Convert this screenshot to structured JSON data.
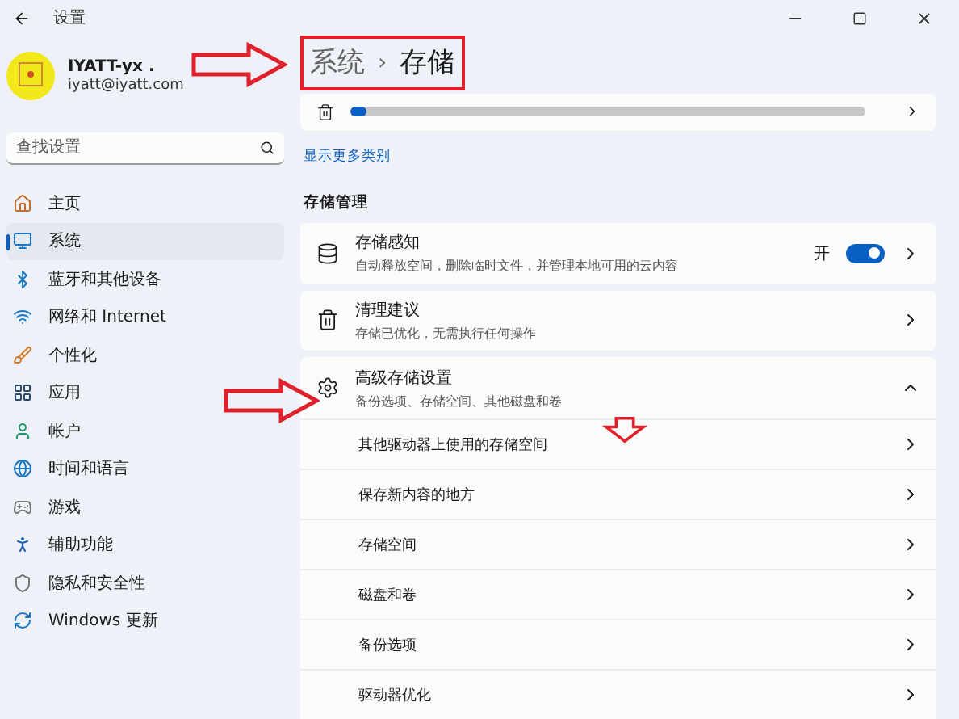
{
  "window": {
    "title": "设置"
  },
  "account": {
    "name": "IYATT-yx .",
    "email": "iyatt@iyatt.com"
  },
  "search": {
    "placeholder": "查找设置"
  },
  "nav": [
    {
      "label": "主页",
      "selected": false
    },
    {
      "label": "系统",
      "selected": true
    },
    {
      "label": "蓝牙和其他设备",
      "selected": false
    },
    {
      "label": "网络和 Internet",
      "selected": false
    },
    {
      "label": "个性化",
      "selected": false
    },
    {
      "label": "应用",
      "selected": false
    },
    {
      "label": "帐户",
      "selected": false
    },
    {
      "label": "时间和语言",
      "selected": false
    },
    {
      "label": "游戏",
      "selected": false
    },
    {
      "label": "辅助功能",
      "selected": false
    },
    {
      "label": "隐私和安全性",
      "selected": false
    },
    {
      "label": "Windows 更新",
      "selected": false
    }
  ],
  "breadcrumb": {
    "parent": "系统",
    "separator": "›",
    "current": "存储"
  },
  "storage_usage": {
    "level": 0.03
  },
  "show_more": "显示更多类别",
  "section_title": "存储管理",
  "settings": [
    {
      "kind": "toggle",
      "title": "存储感知",
      "subtitle": "自动释放空间，删除临时文件，并管理本地可用的云内容",
      "state_label": "开",
      "on": true
    },
    {
      "kind": "link",
      "title": "清理建议",
      "subtitle": "存储已优化，无需执行任何操作"
    },
    {
      "kind": "expander",
      "title": "高级存储设置",
      "subtitle": "备份选项、存储空间、其他磁盘和卷",
      "expanded": true,
      "children": [
        "其他驱动器上使用的存储空间",
        "保存新内容的地方",
        "存储空间",
        "磁盘和卷",
        "备份选项",
        "驱动器优化"
      ]
    }
  ]
}
